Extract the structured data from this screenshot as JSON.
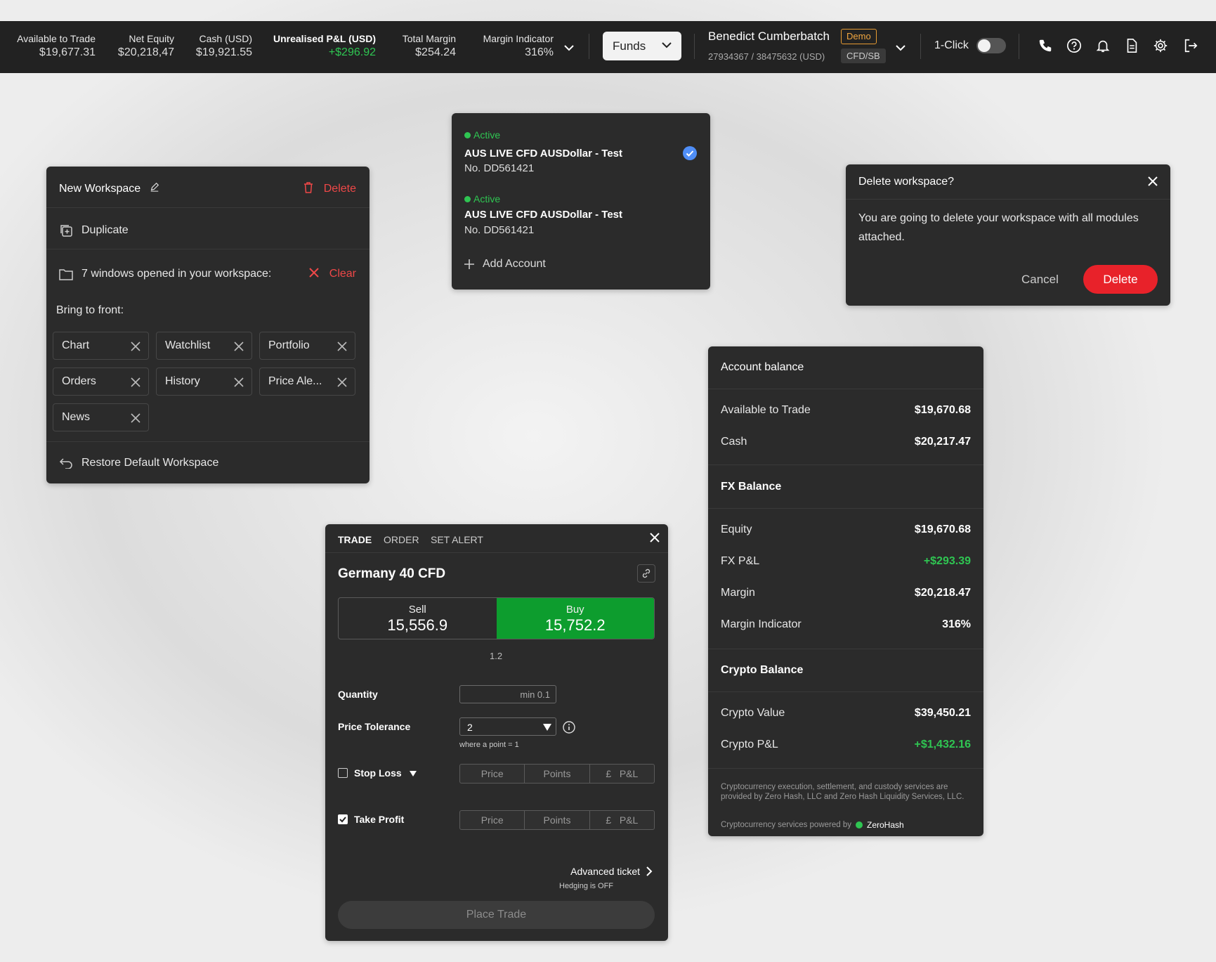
{
  "topbar": {
    "stats": [
      {
        "label": "Available to Trade",
        "value": "$19,677.31"
      },
      {
        "label": "Net Equity",
        "value": "$20,218,47"
      },
      {
        "label": "Cash (USD)",
        "value": "$19,921.55"
      },
      {
        "label": "Unrealised P&L (USD)",
        "value": "+$296.92"
      },
      {
        "label": "Total Margin",
        "value": "$254.24"
      },
      {
        "label": "Margin Indicator",
        "value": "316%"
      }
    ],
    "funds_label": "Funds",
    "user_name": "Benedict Cumberbatch",
    "demo_badge": "Demo",
    "account_ids": "27934367 / 38475632 (USD)",
    "account_type": "CFD/SB",
    "one_click_label": "1-Click",
    "one_click_on": false,
    "icons": [
      "phone-icon",
      "help-icon",
      "bell-icon",
      "document-icon",
      "gear-icon",
      "logout-icon"
    ],
    "accent_green": "#2fc552"
  },
  "workspace": {
    "title": "New Workspace",
    "delete_label": "Delete",
    "duplicate_label": "Duplicate",
    "windows_text": "7 windows opened in your workspace:",
    "clear_label": "Clear",
    "bring_to_front": "Bring to front:",
    "windows": [
      "Chart",
      "Watchlist",
      "Portfolio",
      "Orders",
      "History",
      "Price Ale...",
      "News"
    ],
    "restore_label": "Restore Default Workspace"
  },
  "accounts": {
    "items": [
      {
        "status": "Active",
        "name": "AUS LIVE CFD AUSDollar - Test",
        "number": "No. DD561421",
        "selected": true
      },
      {
        "status": "Active",
        "name": "AUS LIVE CFD AUSDollar - Test",
        "number": "No. DD561421",
        "selected": false
      }
    ],
    "add_label": "Add Account"
  },
  "delete_dialog": {
    "title": "Delete workspace?",
    "body": "You are going to delete your workspace with all modules attached.",
    "cancel_label": "Cancel",
    "delete_label": "Delete"
  },
  "balance": {
    "title": "Account balance",
    "rows_top": [
      {
        "label": "Available to Trade",
        "value": "$19,670.68"
      },
      {
        "label": "Cash",
        "value": "$20,217.47"
      }
    ],
    "fx_title": "FX Balance",
    "rows_fx": [
      {
        "label": "Equity",
        "value": "$19,670.68"
      },
      {
        "label": "FX P&L",
        "value": "+$293.39"
      },
      {
        "label": "Margin",
        "value": "$20,218.47"
      },
      {
        "label": "Margin Indicator",
        "value": "316%"
      }
    ],
    "crypto_title": "Crypto Balance",
    "rows_crypto": [
      {
        "label": "Crypto Value",
        "value": "$39,450.21"
      },
      {
        "label": "Crypto P&L",
        "value": "+$1,432.16"
      }
    ],
    "note": "Cryptocurrency execution, settlement, and custody services are provided by Zero Hash, LLC and Zero Hash Liquidity Services, LLC.",
    "powered_by": "Cryptocurrency services powered by",
    "powered_logo": "ZeroHash"
  },
  "ticket": {
    "tabs": [
      "TRADE",
      "ORDER",
      "SET ALERT"
    ],
    "instrument": "Germany 40 CFD",
    "sell_label": "Sell",
    "sell_price": "15,556.9",
    "buy_label": "Buy",
    "buy_price": "15,752.2",
    "spread": "1.2",
    "quantity_label": "Quantity",
    "quantity_placeholder": "min 0.1",
    "tolerance_label": "Price Tolerance",
    "tolerance_value": "2",
    "tolerance_hint": "where a point = 1",
    "stop_loss_label": "Stop Loss",
    "stop_loss_checked": false,
    "take_profit_label": "Take Profit",
    "take_profit_checked": true,
    "seg_price": "Price",
    "seg_points": "Points",
    "seg_currency": "£",
    "seg_pnl": "P&L",
    "advanced_label": "Advanced ticket",
    "hedging_text": "Hedging is OFF",
    "place_label": "Place Trade"
  }
}
